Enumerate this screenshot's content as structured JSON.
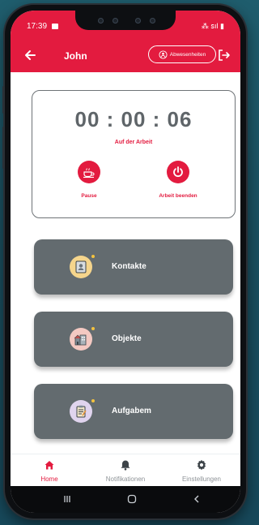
{
  "status_bar": {
    "time": "17:39",
    "right": "⁂ 𝗌ıl ▮"
  },
  "app_bar": {
    "title": "John",
    "absence_button_label": "Abwesenheiten"
  },
  "timer": {
    "time": "00 : 00 : 06",
    "status": "Auf der Arbeit"
  },
  "actions": [
    {
      "label": "Pause"
    },
    {
      "label": "Arbeit beenden"
    }
  ],
  "menu": [
    {
      "label": "Kontakte",
      "icon": "contacts-icon"
    },
    {
      "label": "Objekte",
      "icon": "buildings-icon"
    },
    {
      "label": "Aufgabem",
      "icon": "clipboard-icon"
    }
  ],
  "bottom_nav": [
    {
      "label": "Home",
      "icon": "home-icon",
      "active": true
    },
    {
      "label": "Notifikationen",
      "icon": "bell-icon",
      "active": false
    },
    {
      "label": "Einstellungen",
      "icon": "gear-icon",
      "active": false
    }
  ],
  "colors": {
    "primary": "#e31b3f",
    "card": "#636b6f",
    "timer_text": "#5f6569",
    "background": "#1f5d6d"
  }
}
